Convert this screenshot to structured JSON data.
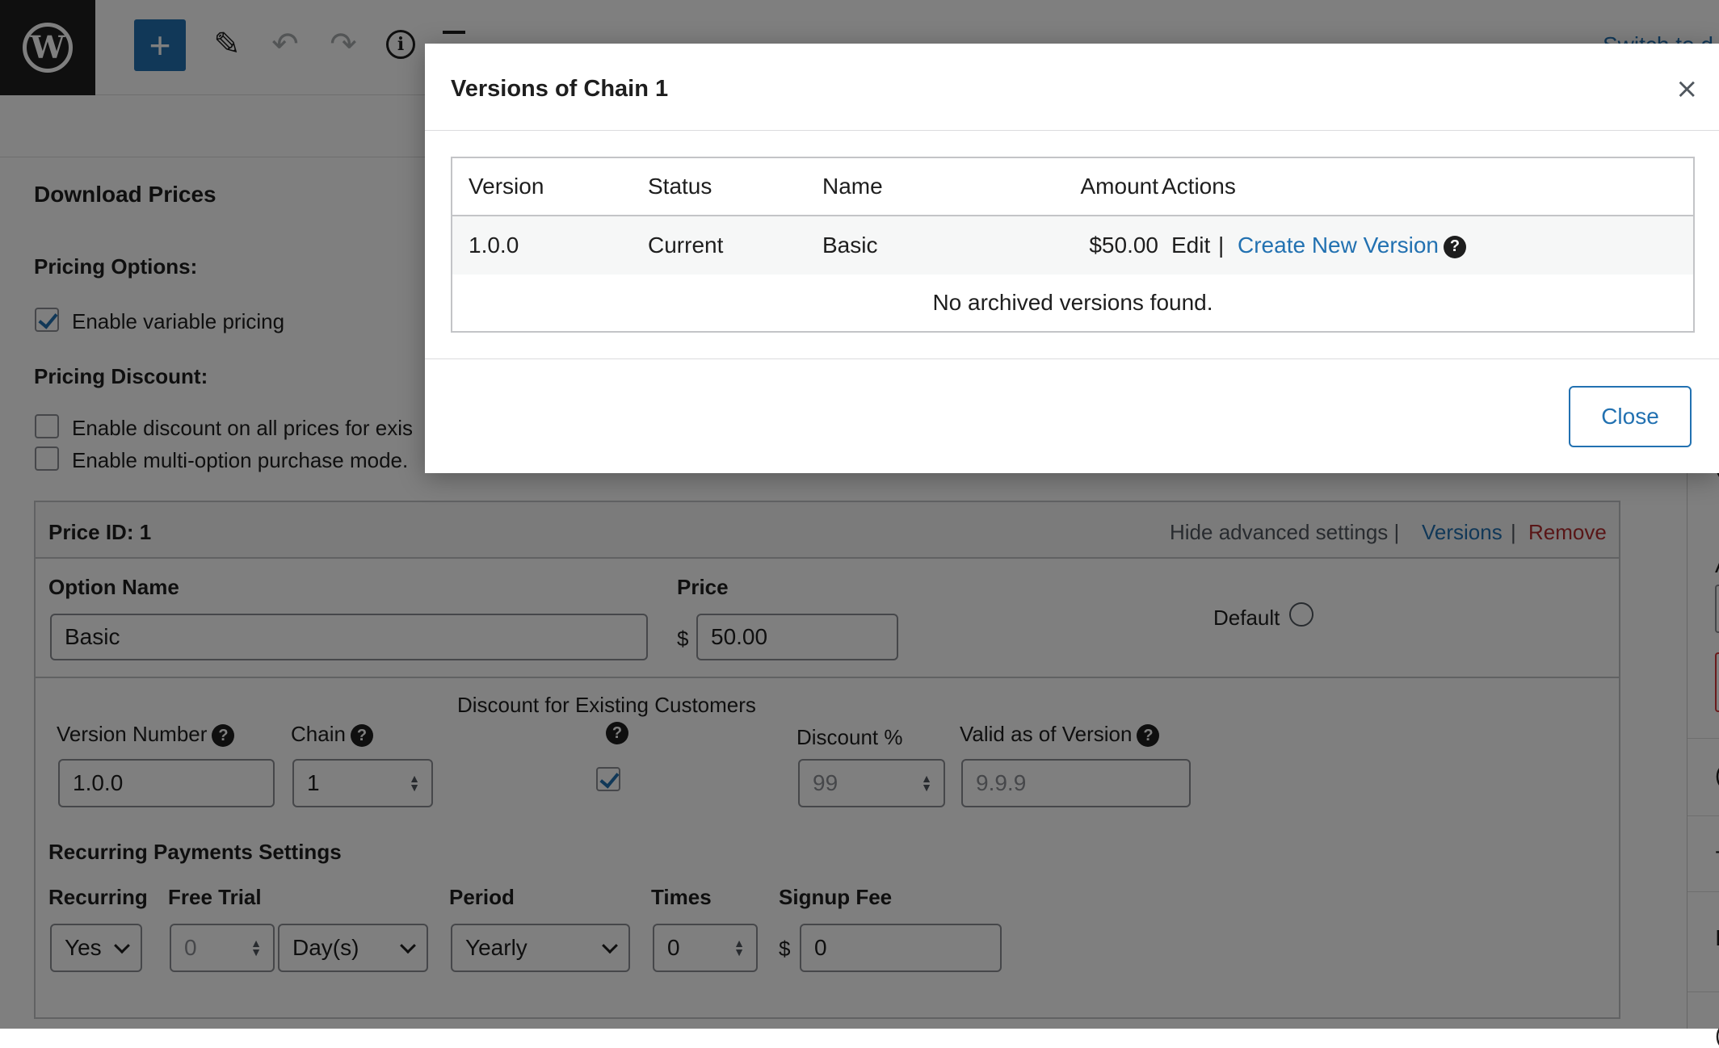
{
  "toolbar": {
    "switch_link": "Switch to d"
  },
  "panel": {
    "title": "Download Prices",
    "pricing_options_label": "Pricing Options:",
    "enable_variable_pricing": "Enable variable pricing",
    "pricing_discount_label": "Pricing Discount:",
    "enable_discount": "Enable discount on all prices for exis",
    "enable_multi_option": "Enable multi-option purchase mode."
  },
  "price": {
    "id_label": "Price ID: 1",
    "hide_advanced": "Hide advanced settings |",
    "versions_link": "Versions",
    "sep": "|",
    "remove_link": "Remove",
    "option_name_label": "Option Name",
    "option_name_value": "Basic",
    "price_label": "Price",
    "currency": "$",
    "price_value": "50.00",
    "default_label": "Default",
    "discount_existing_label": "Discount for Existing Customers",
    "version_number_label": "Version Number",
    "version_number_value": "1.0.0",
    "chain_label": "Chain",
    "chain_value": "1",
    "discount_pct_label": "Discount %",
    "discount_pct_value": "99",
    "valid_as_of_label": "Valid as of Version",
    "valid_as_of_value": "9.9.9",
    "recurring_heading": "Recurring Payments Settings",
    "recurring_label": "Recurring",
    "recurring_value": "Yes",
    "free_trial_label": "Free Trial",
    "free_trial_value": "0",
    "free_trial_unit": "Day(s)",
    "period_label": "Period",
    "period_value": "Yearly",
    "times_label": "Times",
    "times_value": "0",
    "signup_fee_label": "Signup Fee",
    "signup_currency": "$",
    "signup_fee_value": "0"
  },
  "modal": {
    "title": "Versions of Chain 1",
    "close_x": "×",
    "columns": {
      "version": "Version",
      "status": "Status",
      "name": "Name",
      "amount": "Amount",
      "actions": "Actions"
    },
    "rows": [
      {
        "version": "1.0.0",
        "status": "Current",
        "name": "Basic",
        "amount": "$50.00",
        "edit": "Edit",
        "sep": "|",
        "create_new": "Create New Version"
      }
    ],
    "empty_text": "No archived versions found.",
    "close_button": "Close"
  }
}
